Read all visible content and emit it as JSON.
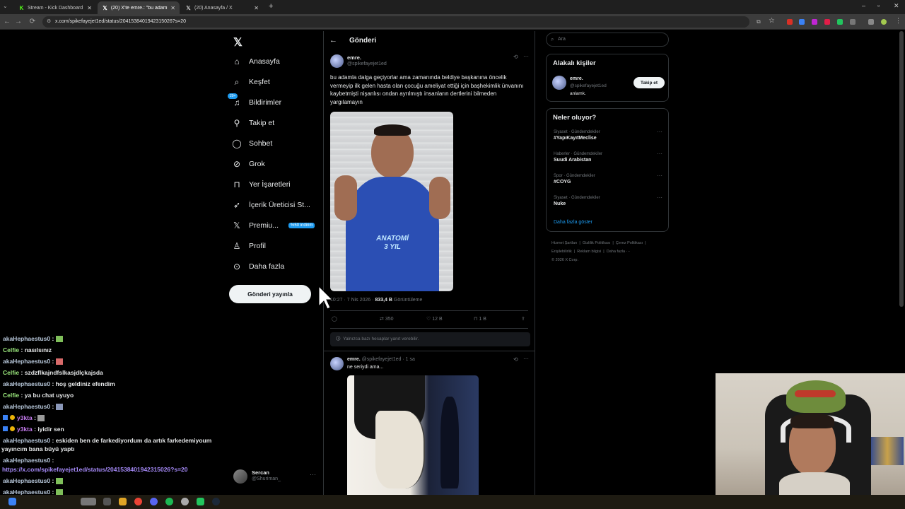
{
  "browser": {
    "tabs": [
      {
        "title": "Stream - Kick Dashboard",
        "icon": "kick-icon"
      },
      {
        "title": "(20) X'te emre.: \"bu adamla dal",
        "icon": "x-logo-icon"
      },
      {
        "title": "(20) Anasayfa / X",
        "icon": "x-logo-icon"
      }
    ],
    "url": "x.com/spikefayejet1ed/status/2041538401942315026?s=20"
  },
  "nav": {
    "items": [
      {
        "label": "Anasayfa",
        "icon": "home-icon"
      },
      {
        "label": "Keşfet",
        "icon": "search-icon"
      },
      {
        "label": "Bildirimler",
        "icon": "bell-icon",
        "badge": "20+"
      },
      {
        "label": "Takip et",
        "icon": "follow-icon"
      },
      {
        "label": "Sohbet",
        "icon": "chat-icon"
      },
      {
        "label": "Grok",
        "icon": "grok-icon"
      },
      {
        "label": "Yer İşaretleri",
        "icon": "bookmark-icon"
      },
      {
        "label": "İçerik Üreticisi St...",
        "icon": "rocket-icon"
      },
      {
        "label": "Premiu...",
        "icon": "x-logo-icon",
        "pill": "%50 indirim"
      },
      {
        "label": "Profil",
        "icon": "profile-icon"
      },
      {
        "label": "Daha fazla",
        "icon": "more-icon"
      }
    ],
    "post_button": "Gönderi yayınla",
    "account": {
      "name": "Sercan",
      "handle": "@Shuriman_"
    }
  },
  "main": {
    "header": "Gönderi",
    "post": {
      "author": "emre.",
      "handle": "@spikefayejet1ed",
      "text": "bu adamla dalga geçiyorlar ama zamanında beldiye başkanına öncelik vermeyip ilk gelen hasta olan çocuğu ameliyat ettiği için başhekimlik ünvanını kaybetmişti nişanlısı ondan ayrılmıştı insanların dertlerini bilmeden yargılamayın",
      "shirt_text_1": "ANATOMİ",
      "shirt_text_2": "3 YIL",
      "time": "10:27 · 7 Nis 2026 ·",
      "views_value": "833,4 B",
      "views_label": "Görüntüleme",
      "reposts": "350",
      "likes": "12 B",
      "bookmarks": "1 B",
      "reply_restriction": "Yalnızca bazı hesaplar yanıt verebilir."
    },
    "reply": {
      "author": "emre.",
      "handle": "@spikefayejet1ed · 1 sa",
      "text": "ne seriydi ama..."
    }
  },
  "right": {
    "search_placeholder": "Ara",
    "related_title": "Alakalı kişiler",
    "related": {
      "name": "emre.",
      "handle": "@spikefayejet1ed",
      "bio": "anlamk.",
      "follow": "Takip et"
    },
    "trends_title": "Neler oluyor?",
    "trends": [
      {
        "meta": "Siyaset · Gündemdekiler",
        "name": "#YapıKayıtMeclise"
      },
      {
        "meta": "Haberler · Gündemdekiler",
        "name": "Suudi Arabistan"
      },
      {
        "meta": "Spor · Gündemdekiler",
        "name": "#COYG"
      },
      {
        "meta": "Siyaset · Gündemdekiler",
        "name": "Nuke"
      }
    ],
    "show_more": "Daha fazla göster",
    "footer": [
      "Hizmet Şartları",
      "Gizlilik Politikası",
      "Çerez Politikası",
      "Erişilebilirlik",
      "Reklam bilgisi",
      "Daha fazla ···",
      "© 2026 X Corp."
    ]
  },
  "chat": {
    "lines": [
      {
        "user": "akaHephaestus0",
        "msg": "",
        "color": "blue"
      },
      {
        "user": "Celfie",
        "msg": "nasılsınız",
        "color": "green"
      },
      {
        "user": "akaHephaestus0",
        "msg": "",
        "color": "blue"
      },
      {
        "user": "Celfie",
        "msg": "szdzflkajndfslkasjdlçkajsda",
        "color": "green"
      },
      {
        "user": "akaHephaestus0",
        "msg": "hoş geldiniz efendim",
        "color": "blue"
      },
      {
        "user": "Celfie",
        "msg": "ya bu chat uyuyo",
        "color": "green"
      },
      {
        "user": "akaHephaestus0",
        "msg": "",
        "color": "blue"
      },
      {
        "user": "y3kta",
        "msg": "",
        "color": "purple"
      },
      {
        "user": "y3kta",
        "msg": "iyidir sen",
        "color": "purple"
      },
      {
        "user": "akaHephaestus0",
        "msg": "eskiden ben de farkediyordum da artık farkedemiyoum",
        "color": "blue"
      },
      {
        "user": "",
        "msg": "yayıncım bana büyü yaptı",
        "color": "blue"
      },
      {
        "user": "akaHephaestus0",
        "msg": "",
        "color": "blue"
      },
      {
        "user": "",
        "msg": "https://x.com/spikefayejet1ed/status/2041538401942315026?s=20",
        "color": "link"
      },
      {
        "user": "akaHephaestus0",
        "msg": "",
        "color": "blue"
      },
      {
        "user": "akaHephaestus0",
        "msg": "",
        "color": "blue"
      }
    ]
  },
  "colors": {
    "accent": "#1d9bf0",
    "background": "#000000",
    "border": "#2f3336",
    "muted": "#71767b"
  }
}
